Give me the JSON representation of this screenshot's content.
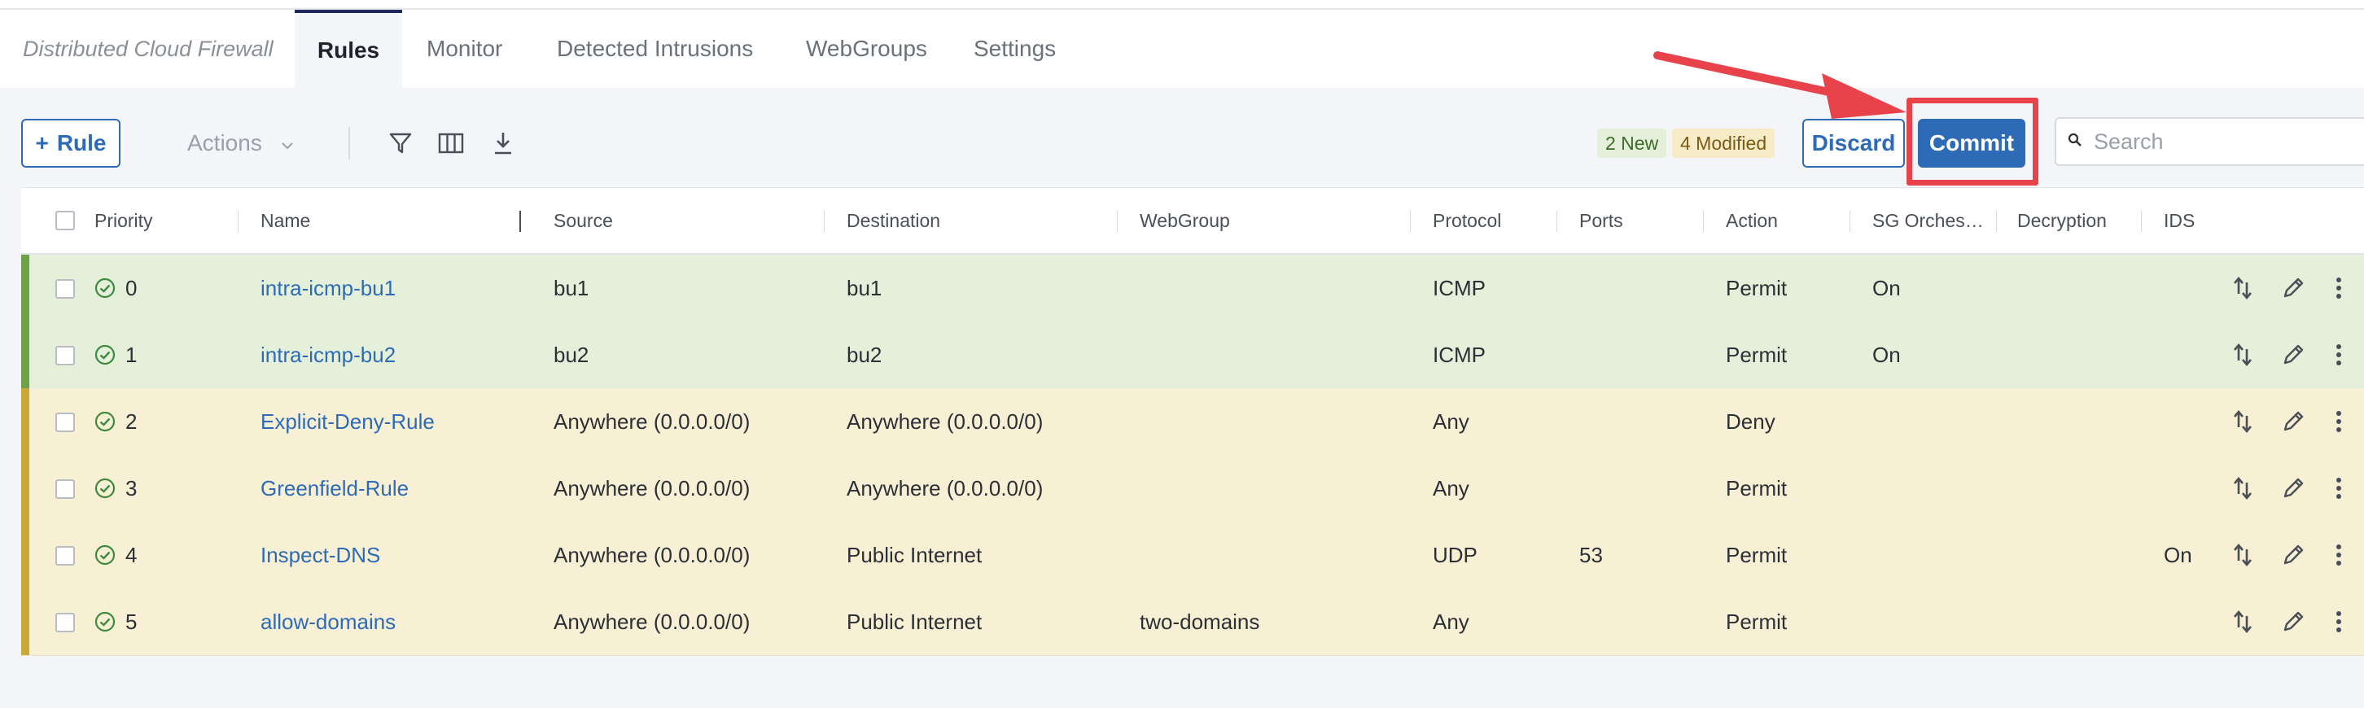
{
  "app": {
    "brand": "Distributed Cloud Firewall"
  },
  "tabs": [
    {
      "label": "Rules",
      "active": true
    },
    {
      "label": "Monitor"
    },
    {
      "label": "Detected Intrusions"
    },
    {
      "label": "WebGroups"
    },
    {
      "label": "Settings"
    }
  ],
  "toolbar": {
    "add_rule_label": "Rule",
    "actions_label": "Actions",
    "new_badge": "2 New",
    "modified_badge": "4 Modified",
    "discard_label": "Discard",
    "commit_label": "Commit",
    "search_placeholder": "Search"
  },
  "table": {
    "columns": [
      "Priority",
      "Name",
      "Source",
      "Destination",
      "WebGroup",
      "Protocol",
      "Ports",
      "Action",
      "SG Orchest…",
      "Decryption",
      "IDS"
    ],
    "rows": [
      {
        "status": "new",
        "priority": "0",
        "name": "intra-icmp-bu1",
        "source": "bu1",
        "destination": "bu1",
        "webgroup": "",
        "protocol": "ICMP",
        "ports": "",
        "action": "Permit",
        "sg": "On",
        "decryption": "",
        "ids": ""
      },
      {
        "status": "new",
        "priority": "1",
        "name": "intra-icmp-bu2",
        "source": "bu2",
        "destination": "bu2",
        "webgroup": "",
        "protocol": "ICMP",
        "ports": "",
        "action": "Permit",
        "sg": "On",
        "decryption": "",
        "ids": ""
      },
      {
        "status": "modified",
        "priority": "2",
        "name": "Explicit-Deny-Rule",
        "source": "Anywhere (0.0.0.0/0)",
        "destination": "Anywhere (0.0.0.0/0)",
        "webgroup": "",
        "protocol": "Any",
        "ports": "",
        "action": "Deny",
        "sg": "",
        "decryption": "",
        "ids": ""
      },
      {
        "status": "modified",
        "priority": "3",
        "name": "Greenfield-Rule",
        "source": "Anywhere (0.0.0.0/0)",
        "destination": "Anywhere (0.0.0.0/0)",
        "webgroup": "",
        "protocol": "Any",
        "ports": "",
        "action": "Permit",
        "sg": "",
        "decryption": "",
        "ids": ""
      },
      {
        "status": "modified",
        "priority": "4",
        "name": "Inspect-DNS",
        "source": "Anywhere (0.0.0.0/0)",
        "destination": "Public Internet",
        "webgroup": "",
        "protocol": "UDP",
        "ports": "53",
        "action": "Permit",
        "sg": "",
        "decryption": "",
        "ids": "On"
      },
      {
        "status": "modified",
        "priority": "5",
        "name": "allow-domains",
        "source": "Anywhere (0.0.0.0/0)",
        "destination": "Public Internet",
        "webgroup": "two-domains",
        "protocol": "Any",
        "ports": "",
        "action": "Permit",
        "sg": "",
        "decryption": "",
        "ids": ""
      }
    ]
  },
  "colors": {
    "accent": "#2e6bb7",
    "annotation": "#e8434b",
    "new_row": "#e5f0da",
    "modified_row": "#f8f0d4"
  },
  "icons": [
    "plus-icon",
    "chevron-down-icon",
    "filter-icon",
    "columns-icon",
    "download-icon",
    "search-icon",
    "check-circle-icon",
    "reorder-icon",
    "edit-icon",
    "more-icon"
  ]
}
